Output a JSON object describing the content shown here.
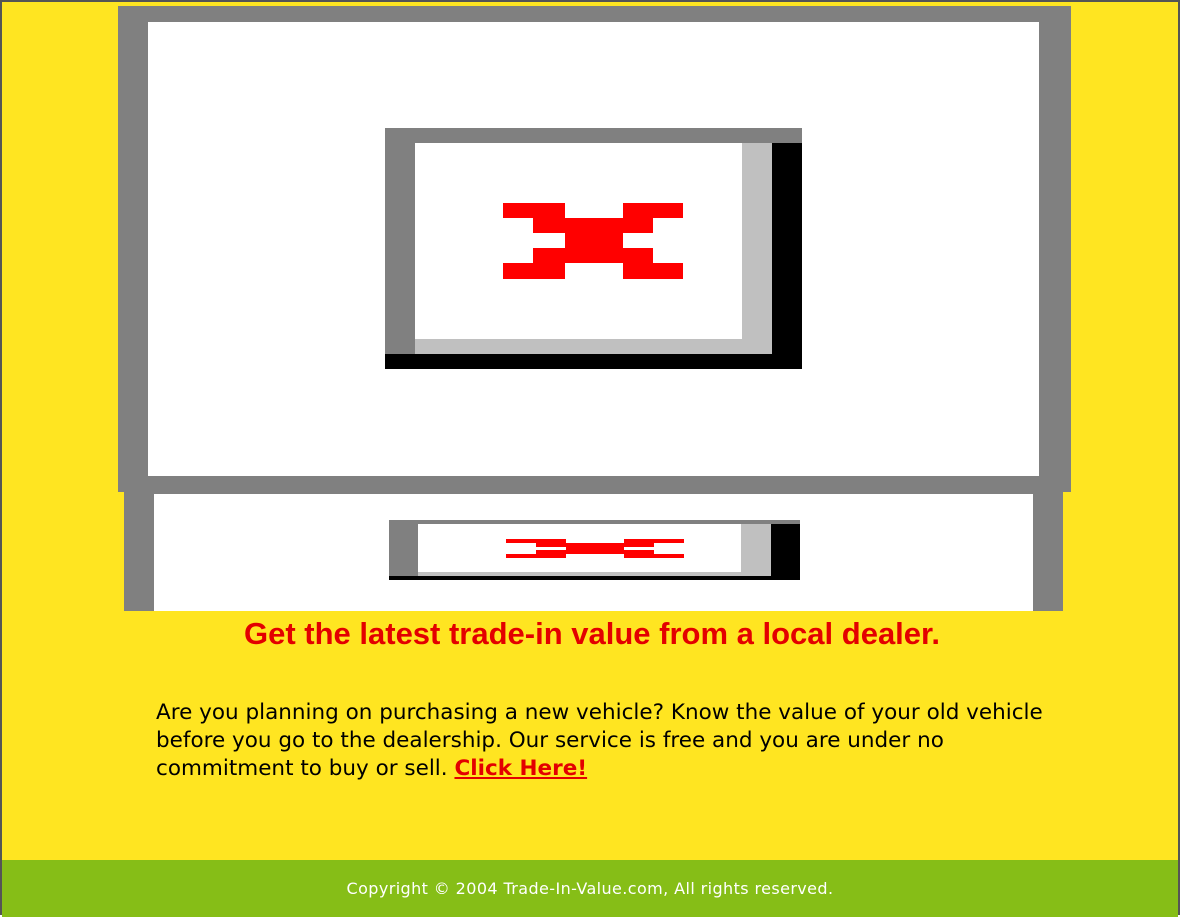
{
  "images": {
    "main_banner": {
      "alt": "",
      "state": "broken-image"
    },
    "secondary_banner": {
      "alt": "",
      "state": "broken-image"
    }
  },
  "headline": "Get the latest trade-in value from a local dealer.",
  "body": {
    "text": "Are you planning on purchasing a new vehicle? Know the value of your old vehicle before you go to the dealership. Our service is free and you are under no commitment to buy or sell.",
    "link_label": "Click Here!"
  },
  "footer": {
    "copyright": "Copyright © 2004 Trade-In-Value.com, All rights reserved."
  },
  "colors": {
    "background": "#ffe521",
    "headline": "#e30000",
    "link": "#e30000",
    "footer_bg": "#86be17",
    "footer_text": "#ffffff",
    "frame": "#808080",
    "broken_x": "#ff0000"
  },
  "icons": [
    "broken-image-icon"
  ]
}
